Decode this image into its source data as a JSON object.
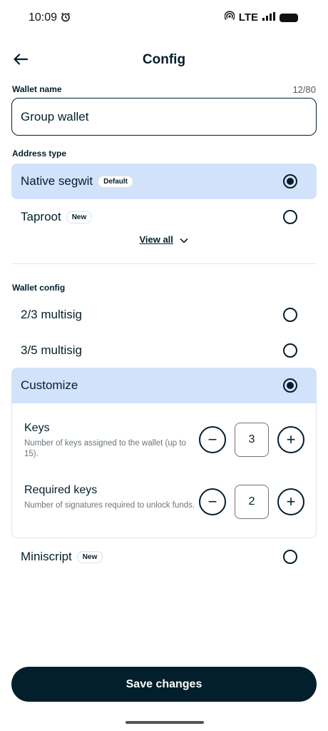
{
  "status_bar": {
    "time": "10:09",
    "network": "LTE"
  },
  "header": {
    "title": "Config"
  },
  "wallet_name": {
    "label": "Wallet name",
    "counter": "12/80",
    "value": "Group wallet"
  },
  "address_type": {
    "label": "Address type",
    "options": [
      {
        "label": "Native segwit",
        "badge": "Default",
        "selected": true
      },
      {
        "label": "Taproot",
        "badge": "New",
        "selected": false
      }
    ],
    "view_all": "View all"
  },
  "wallet_config": {
    "label": "Wallet config",
    "options": [
      {
        "label": "2/3 multisig",
        "selected": false
      },
      {
        "label": "3/5 multisig",
        "selected": false
      },
      {
        "label": "Customize",
        "selected": true
      },
      {
        "label": "Miniscript",
        "badge": "New",
        "selected": false
      }
    ],
    "keys": {
      "title": "Keys",
      "description": "Number of keys assigned to the wallet (up to 15).",
      "value": "3"
    },
    "required_keys": {
      "title": "Required keys",
      "description": "Number of signatures required to unlock funds.",
      "value": "2"
    }
  },
  "save_button": "Save changes",
  "colors": {
    "primary": "#031f2b",
    "selected_bg": "#d2e2fa"
  },
  "icons": {
    "back": "arrow-left-icon",
    "alarm": "alarm-icon",
    "chevron": "chevron-down-icon"
  }
}
